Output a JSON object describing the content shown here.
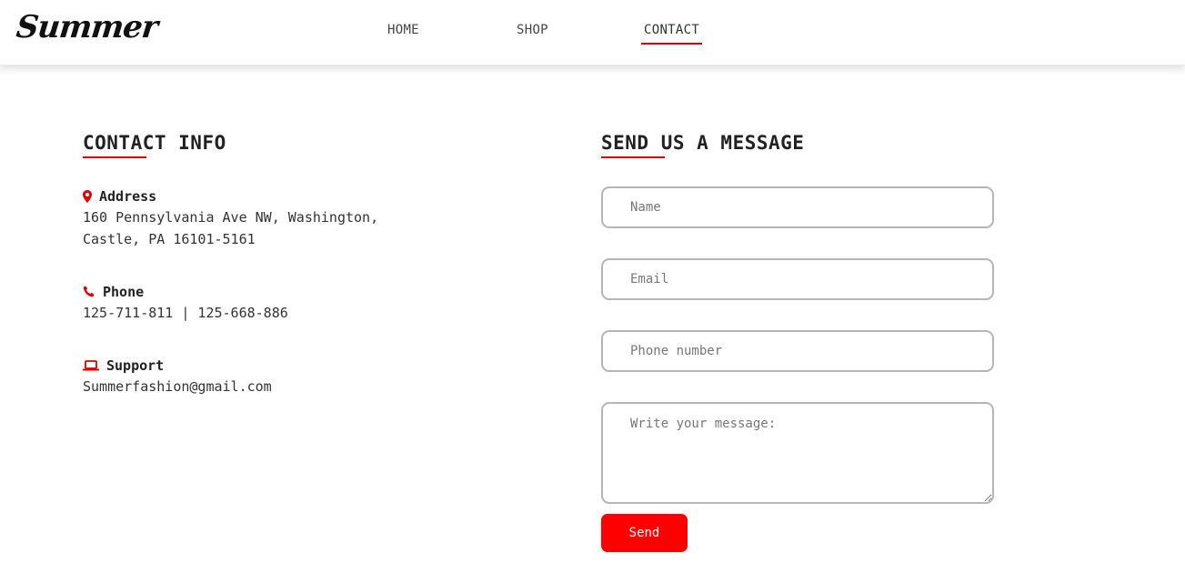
{
  "brand": {
    "logo_text": "Summer"
  },
  "nav": {
    "items": [
      "HOME",
      "SHOP",
      "CONTACT"
    ],
    "active": "CONTACT"
  },
  "contact_info": {
    "title": "CONTACT INFO",
    "address": {
      "icon": "map-pin-icon",
      "label": "Address",
      "line1": "160 Pennsylvania Ave NW, Washington,",
      "line2": "Castle, PA 16101-5161"
    },
    "phone": {
      "icon": "phone-icon",
      "label": "Phone",
      "value": "125-711-811 | 125-668-886"
    },
    "support": {
      "icon": "laptop-icon",
      "label": "Support",
      "value": "Summerfashion@gmail.com"
    }
  },
  "message_form": {
    "title": "SEND US A MESSAGE",
    "name_placeholder": "Name",
    "email_placeholder": "Email",
    "phone_placeholder": "Phone number",
    "message_placeholder": "Write your message:",
    "send_label": "Send"
  },
  "colors": {
    "accent": "#ff0000",
    "underline": "#e00000",
    "border": "#b5b5b5",
    "text": "#222222"
  }
}
